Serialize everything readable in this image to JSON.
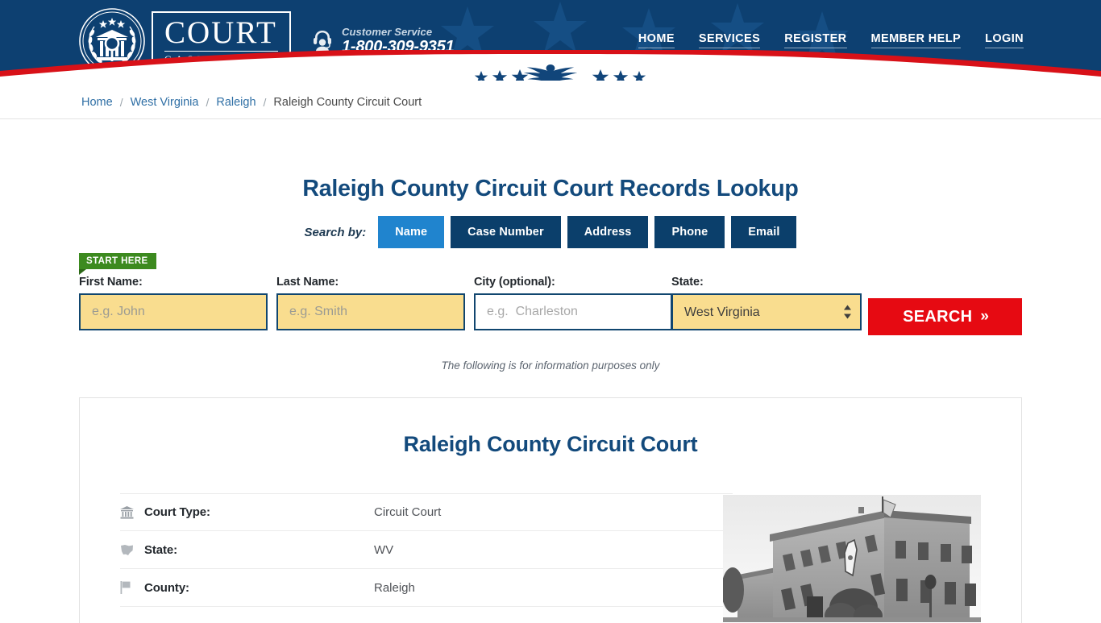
{
  "header": {
    "logo": {
      "icon": "court-seal-icon",
      "primary": "COURT",
      "secondary": "CASE FINDER"
    },
    "customer_service": {
      "icon": "headset-support-icon",
      "label": "Customer Service",
      "phone": "1-800-309-9351"
    },
    "nav": [
      {
        "label": "HOME",
        "name": "nav-home"
      },
      {
        "label": "SERVICES",
        "name": "nav-services"
      },
      {
        "label": "REGISTER",
        "name": "nav-register"
      },
      {
        "label": "MEMBER HELP",
        "name": "nav-member-help"
      },
      {
        "label": "LOGIN",
        "name": "nav-login"
      }
    ],
    "colors": {
      "navy": "#0d4071",
      "red": "#d81118"
    }
  },
  "breadcrumb": {
    "items": [
      {
        "label": "Home",
        "current": false
      },
      {
        "label": "West Virginia",
        "current": false
      },
      {
        "label": "Raleigh",
        "current": false
      },
      {
        "label": "Raleigh County Circuit Court",
        "current": true
      }
    ],
    "separator": "/"
  },
  "main": {
    "page_title": "Raleigh County Circuit Court Records Lookup",
    "search_by_label": "Search by:",
    "tabs": [
      {
        "label": "Name",
        "active": true
      },
      {
        "label": "Case Number",
        "active": false
      },
      {
        "label": "Address",
        "active": false
      },
      {
        "label": "Phone",
        "active": false
      },
      {
        "label": "Email",
        "active": false
      }
    ],
    "start_badge": "START HERE",
    "fields": {
      "first_name": {
        "label": "First Name:",
        "value": "",
        "placeholder": "e.g. John"
      },
      "last_name": {
        "label": "Last Name:",
        "value": "",
        "placeholder": "e.g. Smith"
      },
      "city": {
        "label": "City (optional):",
        "value": "",
        "placeholder": "e.g.  Charleston"
      },
      "state": {
        "label": "State:",
        "value": "West Virginia",
        "options": [
          "West Virginia"
        ]
      }
    },
    "search_button": {
      "label": "SEARCH",
      "chevrons": "»"
    },
    "info_note": "The following is for information purposes only"
  },
  "panel": {
    "title": "Raleigh County Circuit Court",
    "details": [
      {
        "icon": "bank-icon",
        "label": "Court Type:",
        "value": "Circuit Court"
      },
      {
        "icon": "state-map-icon",
        "label": "State:",
        "value": "WV"
      },
      {
        "icon": "flag-icon",
        "label": "County:",
        "value": "Raleigh"
      }
    ],
    "photo_alt": "courthouse-photo"
  },
  "colors": {
    "accent_blue": "#2084ce",
    "tab_navy": "#0b3f6b",
    "title_navy": "#134a7c",
    "field_yellow": "#f9dd8f",
    "field_border": "#11466f",
    "button_red": "#e60a12",
    "badge_green": "#3c8a1f"
  }
}
